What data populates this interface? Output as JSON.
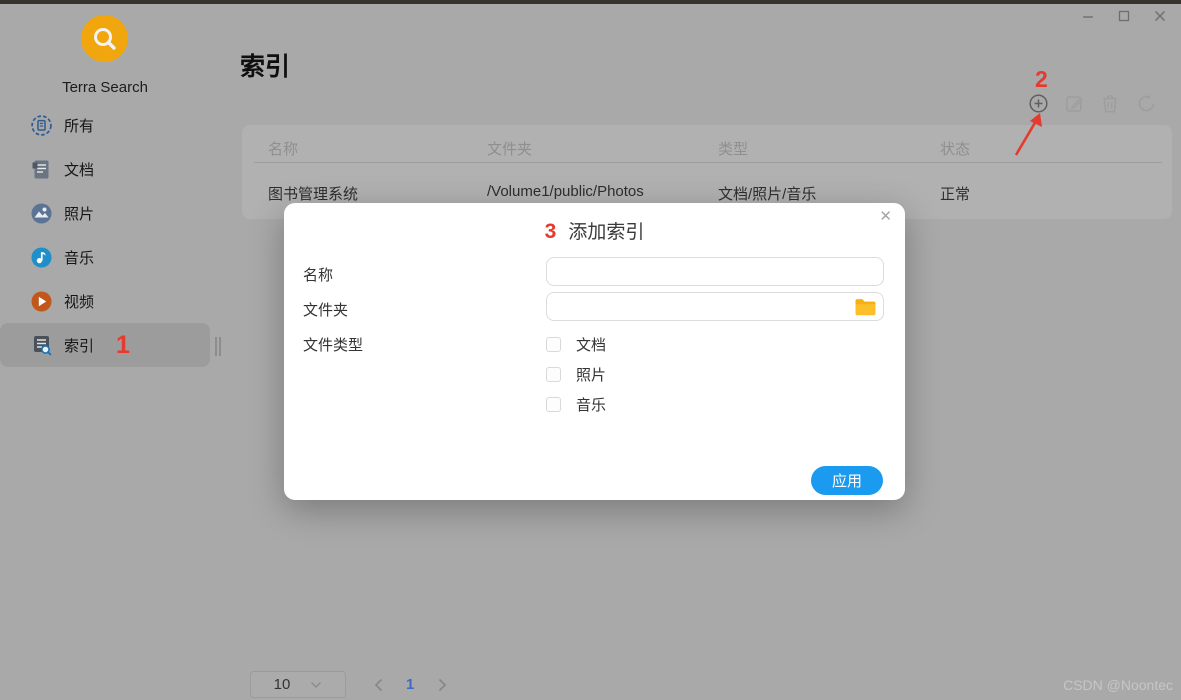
{
  "window": {
    "controls": [
      "minimize",
      "maximize",
      "close"
    ]
  },
  "brand": {
    "name": "Terra Search",
    "logo_color": "#f2a60d"
  },
  "sidebar": {
    "items": [
      {
        "label": "所有",
        "icon": "all-icon",
        "selected": false
      },
      {
        "label": "文档",
        "icon": "document-icon",
        "selected": false
      },
      {
        "label": "照片",
        "icon": "photo-icon",
        "selected": false
      },
      {
        "label": "音乐",
        "icon": "music-icon",
        "selected": false
      },
      {
        "label": "视频",
        "icon": "video-icon",
        "selected": false
      },
      {
        "label": "索引",
        "icon": "index-icon",
        "selected": true
      }
    ]
  },
  "header": {
    "title": "索引"
  },
  "toolbar": {
    "icons": [
      "add",
      "edit",
      "delete",
      "refresh"
    ]
  },
  "table": {
    "columns": [
      "名称",
      "文件夹",
      "类型",
      "状态"
    ],
    "rows": [
      {
        "name": "图书管理系统",
        "folder": "/Volume1/public/Photos",
        "type": "文档/照片/音乐",
        "status": "正常"
      }
    ]
  },
  "pagination": {
    "page_size": "10",
    "current_page": "1"
  },
  "modal": {
    "title": "添加索引",
    "close_glyph": "✕",
    "name_label": "名称",
    "folder_label": "文件夹",
    "file_type_label": "文件类型",
    "name_value": "",
    "folder_value": "",
    "file_types": [
      {
        "label": "文档",
        "checked": false
      },
      {
        "label": "照片",
        "checked": false
      },
      {
        "label": "音乐",
        "checked": false
      }
    ],
    "apply_label": "应用"
  },
  "annotations": {
    "step1": "1",
    "step2": "2",
    "step3": "3",
    "color": "#e53a2e"
  },
  "watermark": "CSDN @Noontec",
  "colors": {
    "accent_blue": "#1b9bf0",
    "folder_yellow": "#fcbf2a",
    "page_number_blue": "#3a6cc8",
    "background_dimmed": "#a9a9a9"
  }
}
